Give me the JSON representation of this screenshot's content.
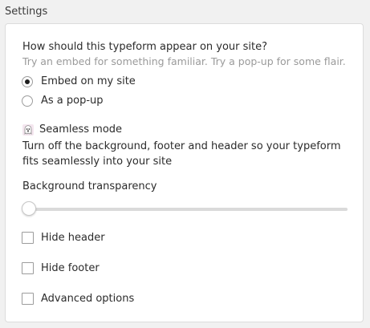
{
  "section_title": "Settings",
  "display": {
    "question": "How should this typeform appear on your site?",
    "hint": "Try an embed for something familiar. Try a pop-up for some flair.",
    "options": [
      {
        "label": "Embed on my site",
        "selected": true
      },
      {
        "label": "As a pop-up",
        "selected": false
      }
    ]
  },
  "seamless": {
    "icon": "ghost-icon",
    "label": "Seamless mode",
    "description": "Turn off the background, footer and header so your typeform fits seamlessly into your site"
  },
  "transparency": {
    "label": "Background transparency",
    "value_fraction": 0
  },
  "checkboxes": [
    {
      "label": "Hide header",
      "checked": false
    },
    {
      "label": "Hide footer",
      "checked": false
    },
    {
      "label": "Advanced options",
      "checked": false
    }
  ]
}
